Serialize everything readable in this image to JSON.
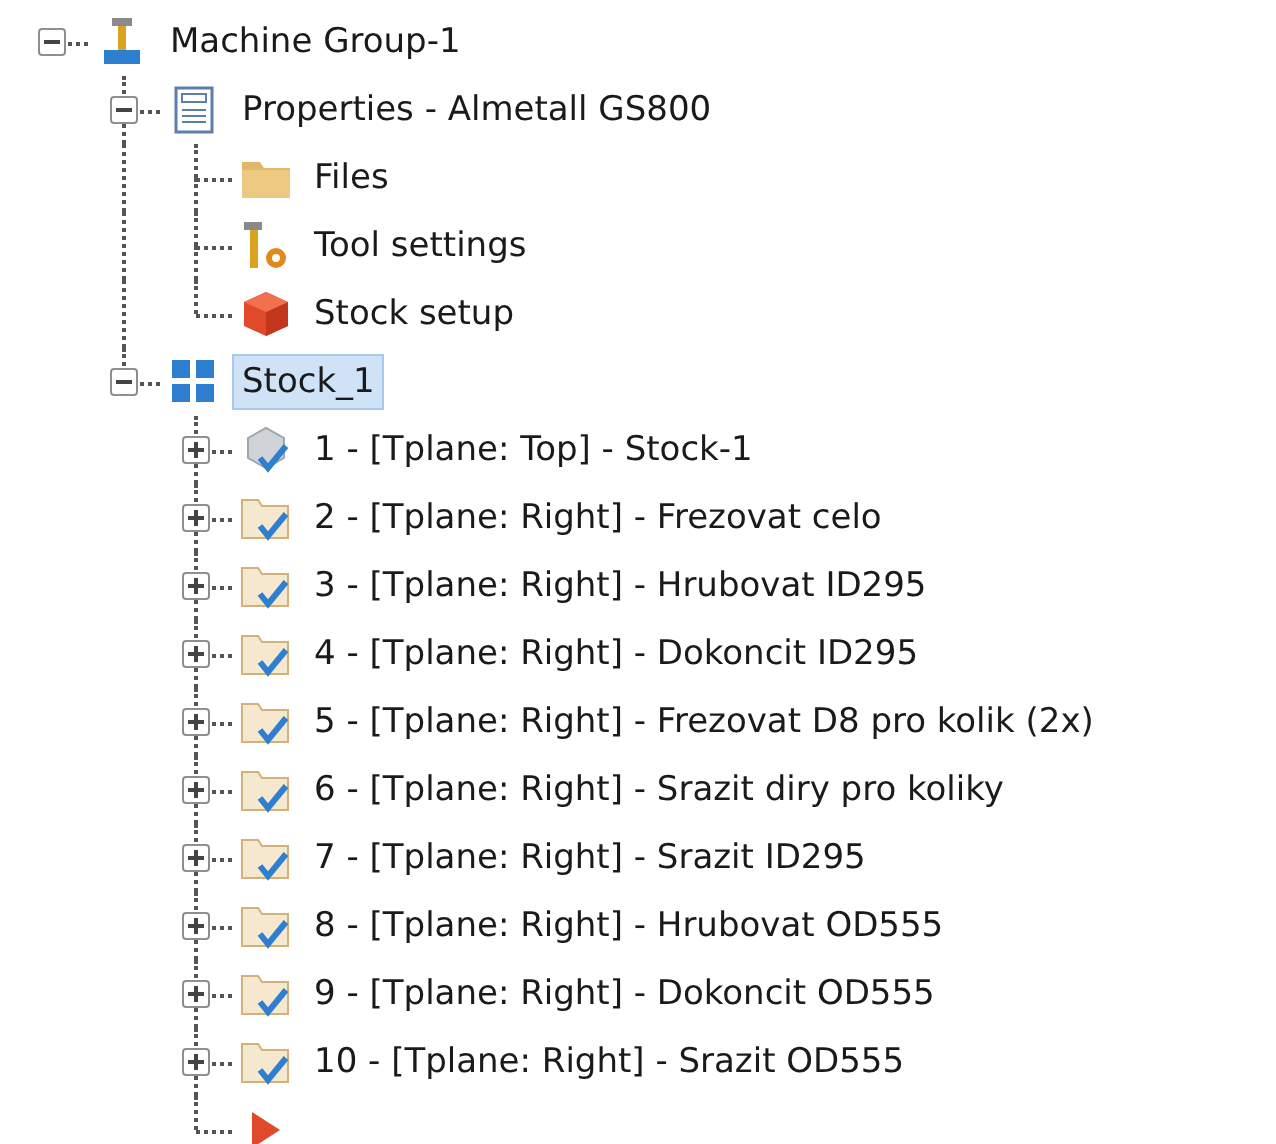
{
  "tree": [
    {
      "kind": "machine",
      "label": "Machine Group-1",
      "selected": false,
      "expanded": true,
      "children": [
        {
          "kind": "properties",
          "label": "Properties - Almetall GS800",
          "selected": false,
          "expanded": true,
          "children": [
            {
              "kind": "folder",
              "label": "Files",
              "selected": false
            },
            {
              "kind": "tool",
              "label": "Tool settings",
              "selected": false
            },
            {
              "kind": "stock",
              "label": "Stock setup",
              "selected": false
            }
          ]
        },
        {
          "kind": "stock-group",
          "label": "Stock_1",
          "selected": true,
          "expanded": true,
          "children": [
            {
              "kind": "stock-op",
              "label": "1 - [Tplane: Top] - Stock-1",
              "selected": false,
              "expanded": false
            },
            {
              "kind": "operation",
              "label": "2 - [Tplane: Right] - Frezovat celo",
              "selected": false,
              "expanded": false
            },
            {
              "kind": "operation",
              "label": "3 - [Tplane: Right] - Hrubovat ID295",
              "selected": false,
              "expanded": false
            },
            {
              "kind": "operation",
              "label": "4 - [Tplane: Right] - Dokoncit ID295",
              "selected": false,
              "expanded": false
            },
            {
              "kind": "operation",
              "label": "5 - [Tplane: Right] - Frezovat D8 pro kolik (2x)",
              "selected": false,
              "expanded": false
            },
            {
              "kind": "operation",
              "label": "6 - [Tplane: Right] - Srazit diry pro koliky",
              "selected": false,
              "expanded": false
            },
            {
              "kind": "operation",
              "label": "7 - [Tplane: Right] - Srazit ID295",
              "selected": false,
              "expanded": false
            },
            {
              "kind": "operation",
              "label": "8 - [Tplane: Right] - Hrubovat OD555",
              "selected": false,
              "expanded": false
            },
            {
              "kind": "operation",
              "label": "9 - [Tplane: Right] - Dokoncit OD555",
              "selected": false,
              "expanded": false
            },
            {
              "kind": "operation",
              "label": "10 - [Tplane: Right] - Srazit OD555",
              "selected": false,
              "expanded": false
            },
            {
              "kind": "insert-marker"
            }
          ]
        }
      ]
    }
  ]
}
